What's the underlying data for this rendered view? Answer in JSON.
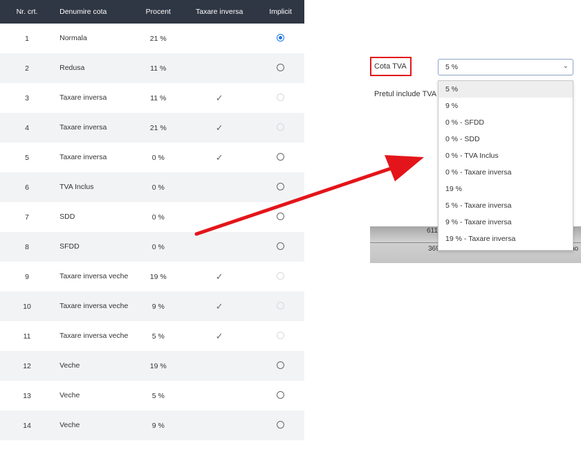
{
  "table": {
    "headers": {
      "nr": "Nr. crt.",
      "name": "Denumire cota",
      "procent": "Procent",
      "taxare": "Taxare inversa",
      "implicit": "Implicit"
    },
    "rows": [
      {
        "nr": "1",
        "name": "Normala",
        "procent": "21 %",
        "taxare": "",
        "implicit": "checked"
      },
      {
        "nr": "2",
        "name": "Redusa",
        "procent": "11 %",
        "taxare": "",
        "implicit": "unchecked"
      },
      {
        "nr": "3",
        "name": "Taxare inversa",
        "procent": "11 %",
        "taxare": "✓",
        "implicit": "disabled"
      },
      {
        "nr": "4",
        "name": "Taxare inversa",
        "procent": "21 %",
        "taxare": "✓",
        "implicit": "disabled"
      },
      {
        "nr": "5",
        "name": "Taxare inversa",
        "procent": "0 %",
        "taxare": "✓",
        "implicit": "unchecked"
      },
      {
        "nr": "6",
        "name": "TVA Inclus",
        "procent": "0 %",
        "taxare": "",
        "implicit": "unchecked"
      },
      {
        "nr": "7",
        "name": "SDD",
        "procent": "0 %",
        "taxare": "",
        "implicit": "unchecked"
      },
      {
        "nr": "8",
        "name": "SFDD",
        "procent": "0 %",
        "taxare": "",
        "implicit": "unchecked"
      },
      {
        "nr": "9",
        "name": "Taxare inversa veche",
        "procent": "19 %",
        "taxare": "✓",
        "implicit": "disabled"
      },
      {
        "nr": "10",
        "name": "Taxare inversa veche",
        "procent": "9 %",
        "taxare": "✓",
        "implicit": "disabled"
      },
      {
        "nr": "11",
        "name": "Taxare inversa veche",
        "procent": "5 %",
        "taxare": "✓",
        "implicit": "disabled"
      },
      {
        "nr": "12",
        "name": "Veche",
        "procent": "19 %",
        "taxare": "",
        "implicit": "unchecked"
      },
      {
        "nr": "13",
        "name": "Veche",
        "procent": "5 %",
        "taxare": "",
        "implicit": "unchecked"
      },
      {
        "nr": "14",
        "name": "Veche",
        "procent": "9 %",
        "taxare": "",
        "implicit": "unchecked"
      }
    ]
  },
  "form": {
    "cota_label": "Cota TVA",
    "pretul_label": "Pretul include TVA",
    "select_value": "5 %",
    "options": [
      "5 %",
      "9 %",
      "0 % - SFDD",
      "0 % - SDD",
      "0 % - TVA Inclus",
      "0 % - Taxare inversa",
      "19 %",
      "5 % - Taxare inversa",
      "9 % - Taxare inversa",
      "19 % - Taxare inversa"
    ],
    "selected_option": 0
  },
  "background_numbers": {
    "a": "611",
    "b": "3695",
    "c": "2500",
    "d": "ho"
  },
  "colors": {
    "header_bg": "#2f3644",
    "highlight_red": "#e3151a",
    "radio_checked": "#1a73e8"
  },
  "icons": {
    "check": "check-icon",
    "chevron": "chevron-down-icon",
    "arrow": "red-arrow"
  }
}
